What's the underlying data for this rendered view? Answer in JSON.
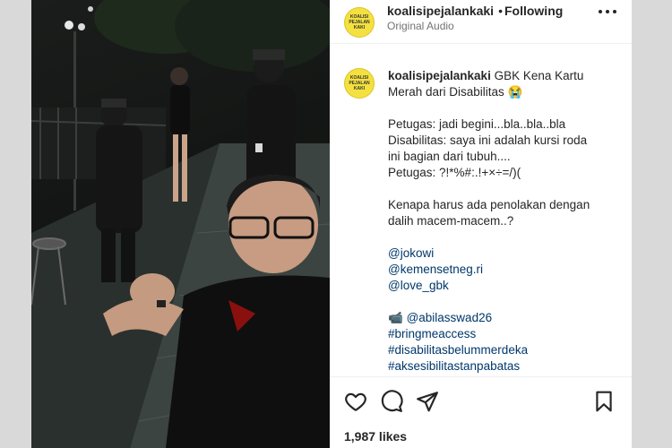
{
  "post": {
    "username": "koalisipejalankaki",
    "dot": "•",
    "follow_status": "Following",
    "audio": "Original Audio",
    "avatar_text": [
      "KOALISI",
      "PEJALAN",
      "KAKI"
    ]
  },
  "caption": {
    "username": "koalisipejalankaki",
    "text_main": " GBK Kena Kartu Merah dari Disabilitas 😭\n\nPetugas: jadi begini...bla..bla..bla\nDisabilitas: saya ini adalah kursi roda ini bagian dari tubuh....\nPetugas: ?!*%#:.!+×÷=/)(\n\nKenapa harus ada penolakan dengan dalih macem-macem..?\n\n",
    "mentions": [
      "@jokowi",
      "@kemensetneg.ri",
      "@love_gbk"
    ],
    "camera_emoji": "📹",
    "credit": "@abilasswad26",
    "hashtags": [
      "#bringmeaccess",
      "#disabilitasbelummerdeka",
      "#aksesibilitastanpabatas"
    ]
  },
  "icons": {
    "like": "heart-icon",
    "comment": "comment-icon",
    "share": "share-icon",
    "save": "bookmark-icon",
    "more": "more-options-icon"
  },
  "likes": "1,987 likes",
  "colors": {
    "accent_link": "#00376b",
    "avatar_yellow": "#f4e13f",
    "text": "#262626",
    "muted": "#737373"
  }
}
